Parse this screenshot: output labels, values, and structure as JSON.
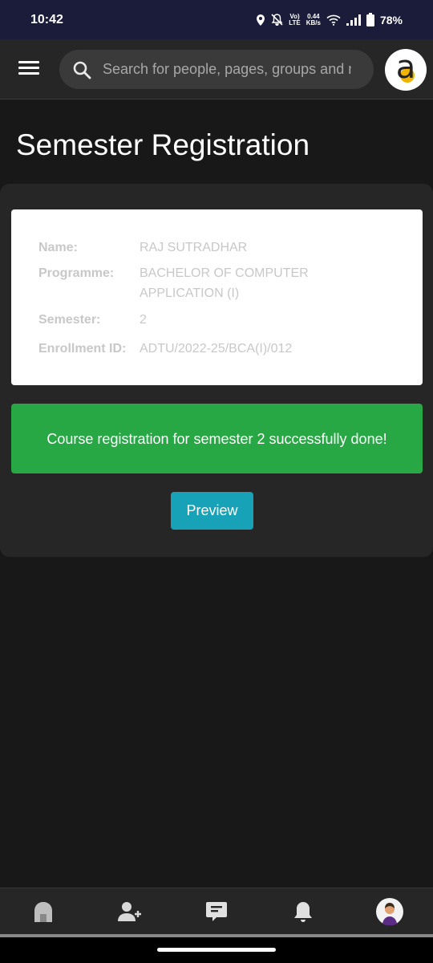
{
  "status_bar": {
    "time": "10:42",
    "battery": "78%",
    "net_speed_value": "0.44",
    "net_speed_unit": "KB/s",
    "volte_top": "Vo)",
    "volte_bottom": "LTE"
  },
  "header": {
    "search_placeholder": "Search for people, pages, groups and more"
  },
  "page": {
    "title": "Semester Registration"
  },
  "student": {
    "name_label": "Name:",
    "name": "RAJ SUTRADHAR",
    "programme_label": "Programme:",
    "programme": "BACHELOR OF COMPUTER APPLICATION (I)",
    "semester_label": "Semester:",
    "semester": "2",
    "enrollment_label": "Enrollment ID:",
    "enrollment_id": "ADTU/2022-25/BCA(I)/012"
  },
  "alert": {
    "message": "Course registration for semester 2 successfully done!"
  },
  "actions": {
    "preview_label": "Preview"
  },
  "colors": {
    "success": "#28a745",
    "info": "#17a2b8",
    "logo_dot": "#f0b400",
    "status_bar": "#1b1b3a"
  },
  "bottom_nav": [
    "home-icon",
    "add-friend-icon",
    "messages-icon",
    "notifications-icon",
    "profile-avatar"
  ]
}
